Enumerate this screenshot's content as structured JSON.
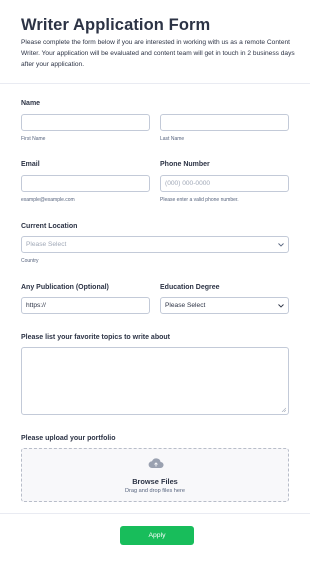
{
  "form": {
    "title": "Writer Application Form",
    "description": "Please complete the form below if you are interested in working with us as a remote Content Writer. Your application will be evaluated and content team will get in touch in 2 business days after your application."
  },
  "name": {
    "label": "Name",
    "first_sublabel": "First Name",
    "last_sublabel": "Last Name",
    "first_value": "",
    "last_value": ""
  },
  "email": {
    "label": "Email",
    "value": "",
    "sublabel": "example@example.com"
  },
  "phone": {
    "label": "Phone Number",
    "placeholder": "(000) 000-0000",
    "value": "",
    "sublabel": "Please enter a valid phone number."
  },
  "location": {
    "label": "Current Location",
    "selected": "Please Select",
    "sublabel": "Country"
  },
  "publication": {
    "label": "Any Publication (Optional)",
    "value": "https://"
  },
  "education": {
    "label": "Education Degree",
    "selected": "Please Select"
  },
  "topics": {
    "label": "Please list your favorite topics to write about",
    "value": ""
  },
  "portfolio": {
    "label": "Please upload your portfolio",
    "browse_label": "Browse Files",
    "drag_text": "Drag and drop files here"
  },
  "submit": {
    "label": "Apply"
  },
  "colors": {
    "accent": "#18bd5b",
    "text": "#2c3345",
    "border": "#c3cad8"
  }
}
